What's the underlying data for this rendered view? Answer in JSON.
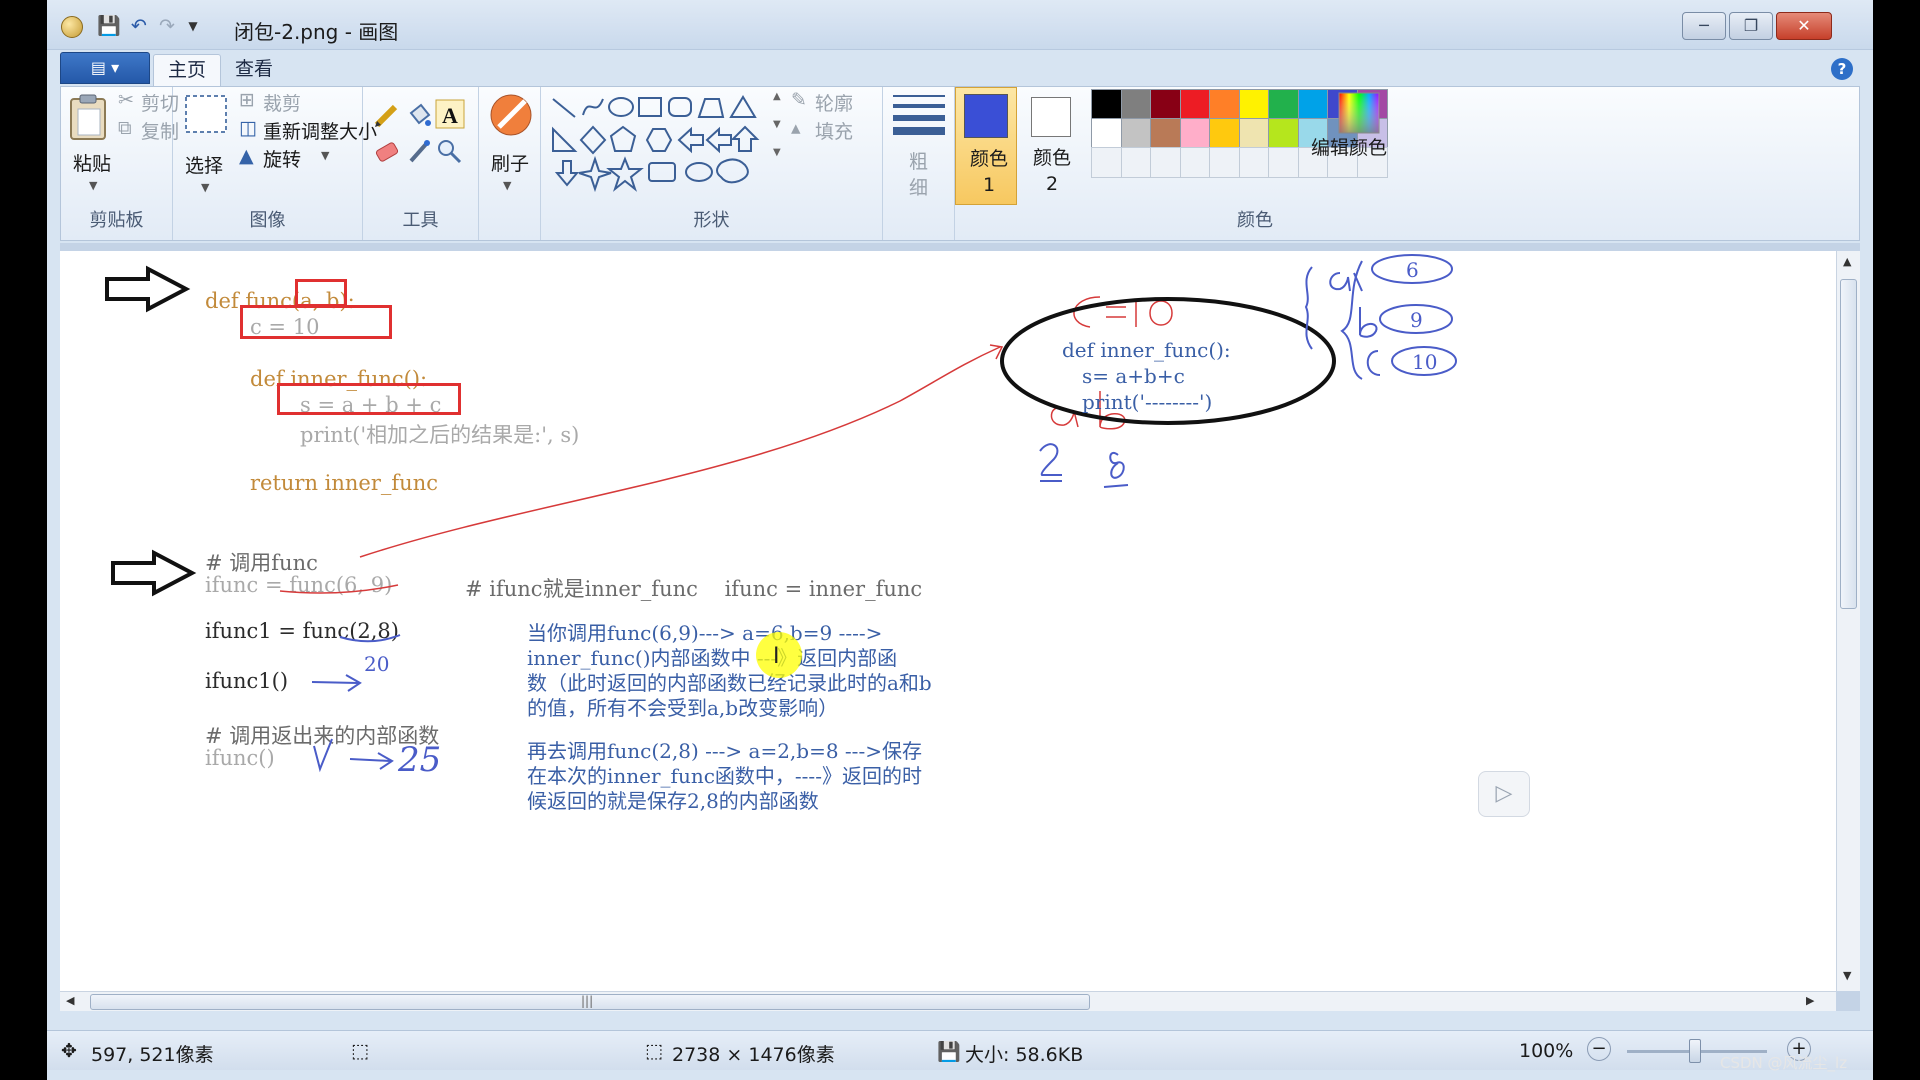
{
  "window": {
    "title": "闭包-2.png - 画图",
    "minimize_icon": "minimize-icon",
    "maximize_icon": "maximize-icon",
    "close_icon": "close-icon"
  },
  "tabs": {
    "home": "主页",
    "view": "查看"
  },
  "ribbon": {
    "clipboard": {
      "paste": "粘贴",
      "cut": "剪切",
      "copy": "复制",
      "group": "剪贴板"
    },
    "image": {
      "select": "选择",
      "crop": "裁剪",
      "resize": "重新调整大小",
      "rotate": "旋转",
      "group": "图像"
    },
    "tools": {
      "group": "工具"
    },
    "brush": {
      "label": "刷子"
    },
    "shapes": {
      "outline": "轮廓",
      "fill": "填充",
      "group": "形状"
    },
    "size": {
      "label": "粗细"
    },
    "colors": {
      "color1": "颜色 1",
      "color2": "颜色 2",
      "edit": "编辑颜色",
      "group": "颜色",
      "color1_value": "#3a4fd6",
      "color2_value": "#ffffff",
      "palette_row1": [
        "#000000",
        "#7f7f7f",
        "#880015",
        "#ed1c24",
        "#ff7f27",
        "#fff200",
        "#22b14c",
        "#00a2e8",
        "#3f48cc",
        "#a349a4"
      ],
      "palette_row2": [
        "#ffffff",
        "#c3c3c3",
        "#b97a57",
        "#ffaec9",
        "#ffc90e",
        "#efe4b0",
        "#b5e61d",
        "#99d9ea",
        "#7092be",
        "#c8bfe7"
      ]
    }
  },
  "canvas": {
    "code": {
      "def_line": "def func(a, b):",
      "c_line": "c = 10",
      "inner_def": "def inner_func():",
      "s_line": "s = a + b + c",
      "print_line": "print('相加之后的结果是:', s)",
      "return_line": "return inner_func",
      "comment_call": "# 调用func",
      "ifunc_line": "ifunc = func(6, 9)",
      "ifunc_comment": "# ifunc就是inner_func    ifunc = inner_func",
      "ifunc1_line": "ifunc1 = func(2,8)",
      "ifunc1_call": "ifunc1()",
      "comment_inner": "# 调用返出来的内部函数",
      "ifunc_call": "ifunc()"
    },
    "note1": [
      "当你调用func(6,9)---> a=6,b=9 ---->",
      "inner_func()内部函数中 ---》返回内部函",
      "数（此时返回的内部函数已经记录此时的a和b",
      "的值，所有不会受到a,b改变影响）"
    ],
    "note2": [
      "再去调用func(2,8) ---> a=2,b=8  --->保存",
      "在本次的inner_func函数中，----》返回的时",
      "候返回的就是保存2,8的内部函数"
    ],
    "diagram": {
      "inner_def": "def inner_func():",
      "inner_s": "s= a+b+c",
      "inner_print": "print('--------')",
      "hand_c": "C=10",
      "hand_ab": "a  b",
      "hand_nums": "2  8",
      "brace_labels": [
        "a",
        "b",
        "c"
      ],
      "brace_values": [
        "6",
        "9",
        "10"
      ],
      "result_20": "20",
      "result_25": "25"
    }
  },
  "status": {
    "cursor": "597, 521像素",
    "dimensions": "2738 × 1476像素",
    "size": "大小: 58.6KB",
    "zoom": "100%"
  },
  "watermark": "CSDN @风流尘_lz"
}
